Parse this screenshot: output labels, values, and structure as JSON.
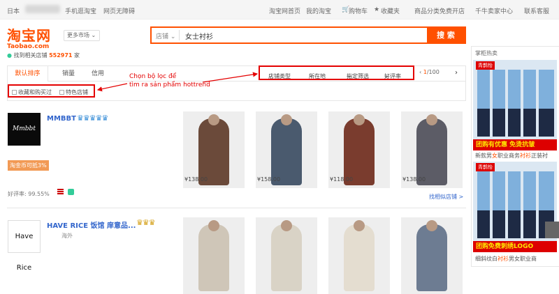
{
  "topbar": {
    "region": "日本",
    "left_links": [
      "手机逛淘宝",
      "网页无障碍"
    ],
    "right_links": [
      "淘宝网首页",
      "我的淘宝",
      "购物车",
      "收藏夹",
      "商品分类",
      "免费开店",
      "千牛卖家中心",
      "联系客服"
    ]
  },
  "logo": {
    "cn": "淘宝网",
    "en": "Taobao.com"
  },
  "market_select": "更多市场",
  "search": {
    "type": "店铺",
    "value": "女士衬衫",
    "button": "搜 索"
  },
  "result_count": {
    "prefix": "找到相关店铺",
    "count": "552971",
    "suffix": "家"
  },
  "sort_tabs": [
    "默认排序",
    "销量",
    "信用"
  ],
  "filters": [
    "店铺类型",
    "所在地",
    "指定筛选",
    "好评率"
  ],
  "pager": {
    "current": "1",
    "total": "/100"
  },
  "checkboxes": [
    "收藏和购买过",
    "特色店铺"
  ],
  "annotation": {
    "line1": "Chọn bộ lọc để",
    "line2": "tìm ra sản phẩm hottrend"
  },
  "annotation_color": "#e40000",
  "stores": [
    {
      "name": "MMBBT",
      "logo_text": "Mmbbt",
      "crowns": "♛♛♛♛♛",
      "badge": "淘金币可抵3%",
      "rating_label": "好评率: ",
      "rating": "99.55%",
      "products": [
        {
          "price": "¥138.00",
          "color": "#6b4a3a"
        },
        {
          "price": "¥158.00",
          "color": "#4a5a6e"
        },
        {
          "price": "¥118.00",
          "color": "#7a3c2e"
        },
        {
          "price": "¥138.00",
          "color": "#5c5c66"
        }
      ],
      "similar": "找相似店铺 >"
    },
    {
      "name": "HAVE RICE 饭馆 庠意品...",
      "logo_text": "Have Rice",
      "crowns": "♛♛♛",
      "location": "海外",
      "products": [
        {
          "color": "#cfc6b8"
        },
        {
          "color": "#d9d3c6"
        },
        {
          "color": "#e4ddd0"
        },
        {
          "color": "#6d7c92"
        }
      ]
    }
  ],
  "sidebar": {
    "title": "掌柜热卖",
    "ads": [
      {
        "brand": "青鹊怡",
        "banner": "团购有优惠  免烫抗皱",
        "text_pre": "新款男",
        "text_hl": "女",
        "text_post": "职业商务",
        "text_hl2": "衬衫",
        "text_end": "正装衬"
      },
      {
        "brand": "青鹊怡",
        "banner": "团购免费刺绣LOGO",
        "text_pre": "细斜纹白",
        "text_hl": "衬衫",
        "text_post": "男女职业商",
        "text_hl2": "",
        "text_end": ""
      }
    ]
  },
  "brand_color": "#ff5000"
}
